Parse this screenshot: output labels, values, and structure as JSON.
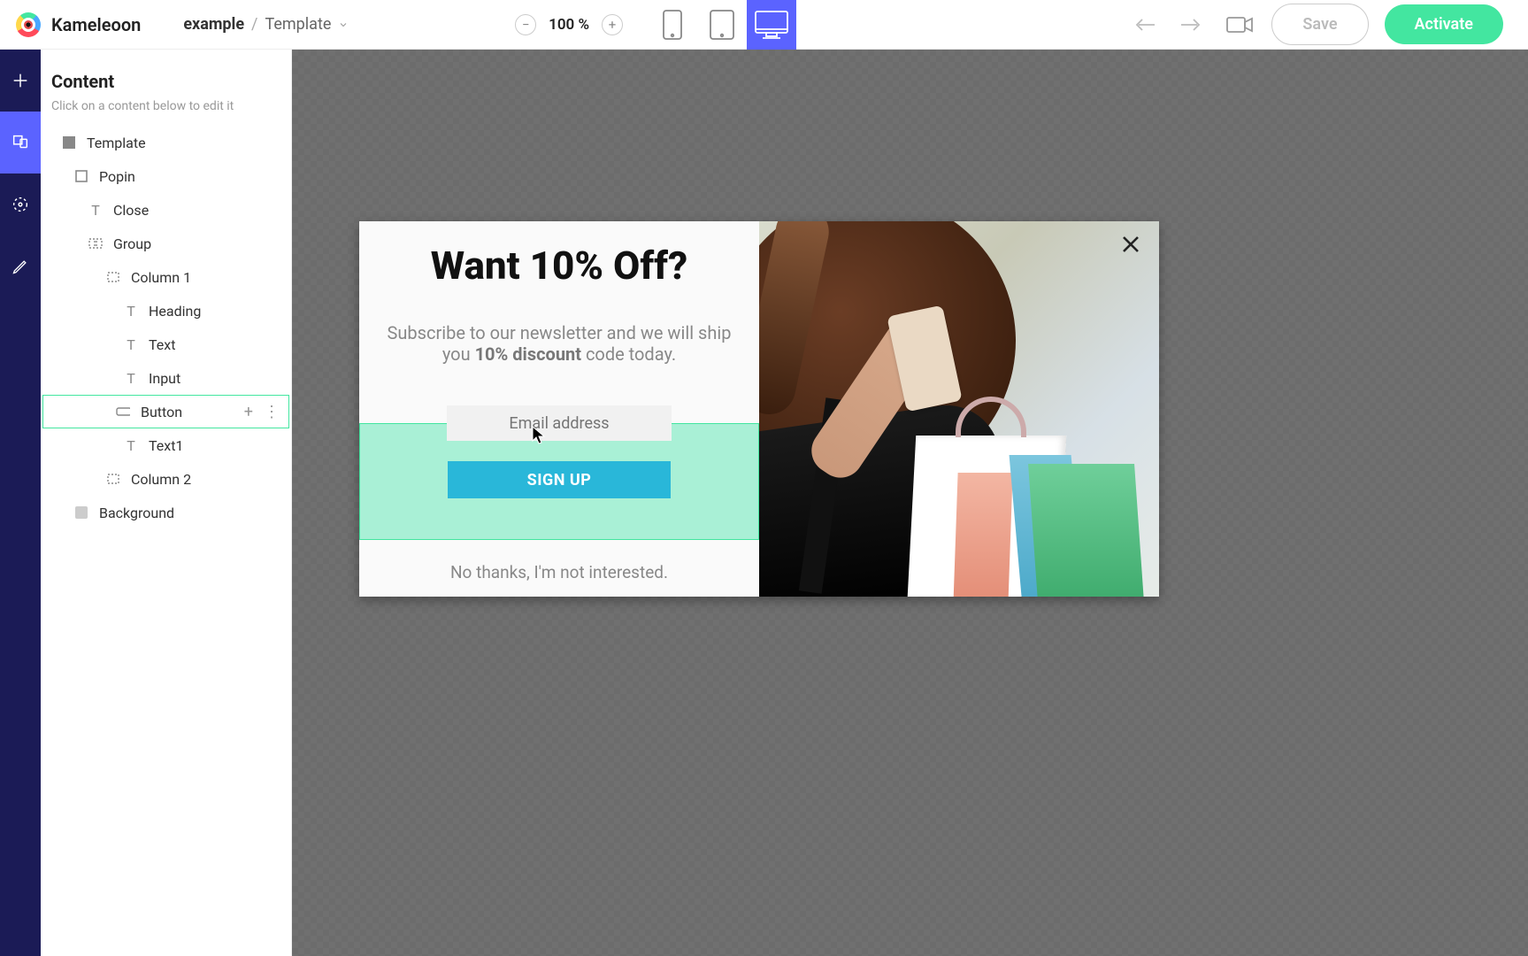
{
  "brand": "Kameleoon",
  "breadcrumb": {
    "project": "example",
    "separator": "/",
    "page": "Template"
  },
  "zoom": {
    "value": "100 %"
  },
  "buttons": {
    "save": "Save",
    "activate": "Activate"
  },
  "panel": {
    "title": "Content",
    "subtitle": "Click on a content below to edit it"
  },
  "tree": {
    "template": "Template",
    "popin": "Popin",
    "close": "Close",
    "group": "Group",
    "column1": "Column 1",
    "heading": "Heading",
    "text": "Text",
    "input": "Input",
    "button": "Button",
    "text1": "Text1",
    "column2": "Column 2",
    "background": "Background"
  },
  "popup": {
    "heading": "Want 10% Off?",
    "text_pre": "Subscribe to our newsletter and we will ship you ",
    "text_bold": "10% discount",
    "text_post": " code today.",
    "email_placeholder": "Email address",
    "signup": "SIGN UP",
    "footer": "No thanks, I'm not interested."
  }
}
